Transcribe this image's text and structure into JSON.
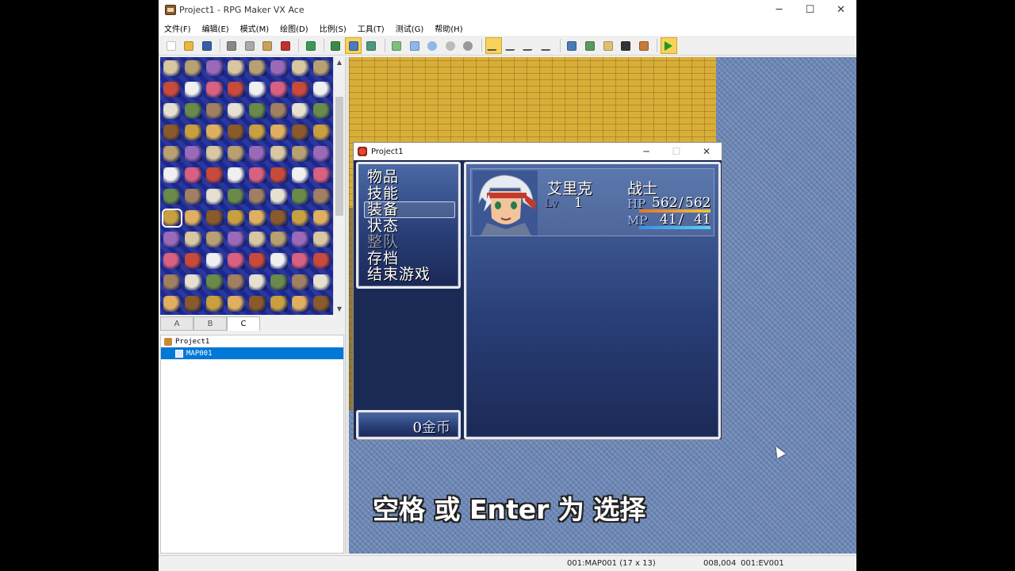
{
  "window": {
    "title": "Project1 - RPG Maker VX Ace",
    "minimize": "─",
    "maximize": "☐",
    "close": "✕"
  },
  "menu": [
    "文件(F)",
    "编辑(E)",
    "模式(M)",
    "绘图(D)",
    "比例(S)",
    "工具(T)",
    "测试(G)",
    "帮助(H)"
  ],
  "toolbar": {
    "groups": [
      [
        "new-project",
        "open-project",
        "save-project"
      ],
      [
        "cut",
        "copy",
        "paste",
        "delete"
      ],
      [
        "undo"
      ],
      [
        "map-layer",
        "event-layer",
        "region-layer"
      ],
      [
        "pencil",
        "rectangle",
        "ellipse",
        "flood-fill",
        "shadow-pen"
      ],
      [
        "zoom-1-1",
        "zoom-1-2",
        "zoom-1-4",
        "zoom-1-8"
      ],
      [
        "database",
        "resource-manager",
        "script-editor",
        "sound-test",
        "character-generator"
      ],
      [
        "playtest"
      ]
    ],
    "active": [
      "event-layer",
      "zoom-1-1",
      "playtest"
    ]
  },
  "tileset_tabs": [
    "A",
    "B",
    "C"
  ],
  "tileset_selected_tab": "C",
  "tree": {
    "root": "Project1",
    "items": [
      "MAP001"
    ],
    "selected": "MAP001"
  },
  "game": {
    "title": "Project1",
    "min": "─",
    "max": "☐",
    "close": "✕",
    "commands": [
      {
        "label": "物品",
        "enabled": true
      },
      {
        "label": "技能",
        "enabled": true
      },
      {
        "label": "装备",
        "enabled": true
      },
      {
        "label": "状态",
        "enabled": true
      },
      {
        "label": "整队",
        "enabled": false
      },
      {
        "label": "存档",
        "enabled": true
      },
      {
        "label": "结束游戏",
        "enabled": true
      }
    ],
    "selected_command": "装备",
    "gold": {
      "value": "0",
      "unit": "金币"
    },
    "actor": {
      "name": "艾里克",
      "class": "战士",
      "level_label": "Lv",
      "level": "1",
      "hp_label": "HP",
      "hp": "562",
      "hp_max": "562",
      "mp_label": "MP",
      "mp": "41",
      "mp_max": "41",
      "hp_fraction": 1.0,
      "mp_fraction": 1.0,
      "hp_color": "#e0782a",
      "mp_color": "#3a8ee8"
    }
  },
  "subtitle": "空格 或 Enter 为 选择",
  "status": {
    "map": "001:MAP001 (17 x 13)",
    "coords": "008,004",
    "event": "001:EV001"
  }
}
